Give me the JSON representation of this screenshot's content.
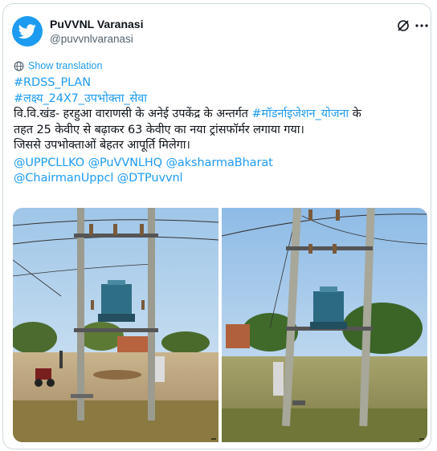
{
  "author": {
    "name": "PuVVNL Varanasi",
    "handle": "@puvvnlvaranasi"
  },
  "icons": {
    "avatar": "twitter-bird-icon",
    "grok": "grok-slash-icon",
    "more": "more-dots-icon",
    "translate": "globe-icon"
  },
  "translate_label": "Show translation",
  "tweet": {
    "hashtag1": "#RDSS_PLAN",
    "hashtag2": "#लक्ष्य_24X7_उपभोक्ता_सेवा",
    "line1_prefix": "वि.वि.खंड- हरहुआ वाराणसी के अनेई उपकेंद्र के अन्तर्गत",
    "line1_hashtag": "#मॉडर्नाइजेशन_योजना",
    "line1_suffix": " के",
    "line2": "तहत 25 केवीए से बढ़ाकर 63 केवीए का नया ट्रांसफॉर्मर लगाया गया।",
    "line3": "जिससे उपभोक्ताओं बेहतर आपूर्ति मिलेगा।",
    "mentions": [
      "@UPPCLLKO",
      "@PuVVNLHQ",
      "@aksharmaBharat",
      "@ChairmanUppcl",
      "@DTPuvvnl"
    ]
  },
  "colors": {
    "link": "#1d9bf0",
    "text": "#0f1419",
    "muted": "#536471",
    "border": "#cfd9de"
  }
}
